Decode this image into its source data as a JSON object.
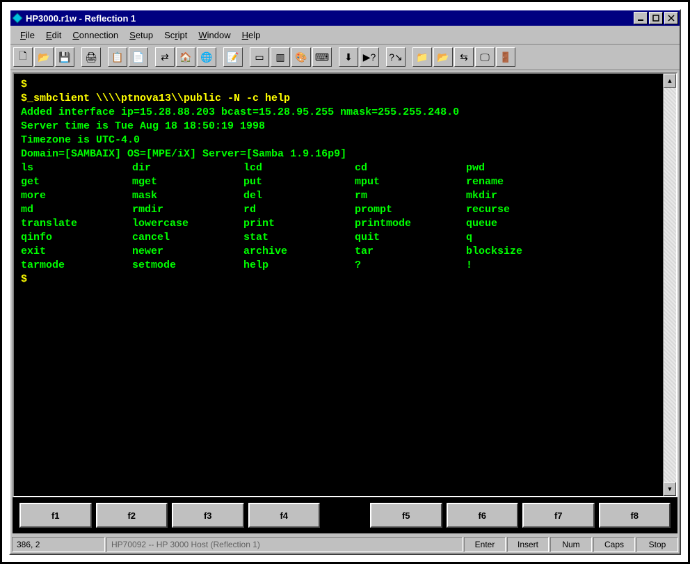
{
  "window": {
    "title": "HP3000.r1w - Reflection 1",
    "icon_name": "app-icon"
  },
  "menu": {
    "items": [
      {
        "label": "File",
        "accel": "F"
      },
      {
        "label": "Edit",
        "accel": "E"
      },
      {
        "label": "Connection",
        "accel": "C"
      },
      {
        "label": "Setup",
        "accel": "S"
      },
      {
        "label": "Script",
        "accel": "r"
      },
      {
        "label": "Window",
        "accel": "W"
      },
      {
        "label": "Help",
        "accel": "H"
      }
    ]
  },
  "toolbar": {
    "buttons": [
      {
        "name": "new-doc-icon",
        "glyph": "🗋"
      },
      {
        "name": "open-folder-icon",
        "glyph": "📂"
      },
      {
        "name": "save-disk-icon",
        "glyph": "💾"
      },
      {
        "sep": true
      },
      {
        "name": "print-icon",
        "glyph": "🖨"
      },
      {
        "sep": true
      },
      {
        "name": "copy-icon",
        "glyph": "📋"
      },
      {
        "name": "paste-icon",
        "glyph": "📄"
      },
      {
        "sep": true
      },
      {
        "name": "connect-icon",
        "glyph": "⇄"
      },
      {
        "name": "home-icon",
        "glyph": "🏠"
      },
      {
        "name": "globe-icon",
        "glyph": "🌐"
      },
      {
        "sep": true
      },
      {
        "name": "notepad-icon",
        "glyph": "📝"
      },
      {
        "sep": true
      },
      {
        "name": "window-a-icon",
        "glyph": "▭"
      },
      {
        "name": "window-b-icon",
        "glyph": "▥"
      },
      {
        "name": "palette-icon",
        "glyph": "🎨"
      },
      {
        "name": "keyboard-icon",
        "glyph": "⌨"
      },
      {
        "sep": true
      },
      {
        "name": "download-icon",
        "glyph": "⬇"
      },
      {
        "name": "run-script-icon",
        "glyph": "▶?"
      },
      {
        "sep": true
      },
      {
        "name": "context-help-icon",
        "glyph": "?↘"
      },
      {
        "sep": true
      },
      {
        "name": "folder-out-icon",
        "glyph": "📁"
      },
      {
        "name": "folder-in-icon",
        "glyph": "📂"
      },
      {
        "name": "transfer-icon",
        "glyph": "⇆"
      },
      {
        "name": "display-icon",
        "glyph": "🖵"
      },
      {
        "name": "exit-icon",
        "glyph": "🚪"
      }
    ]
  },
  "terminal": {
    "prompt": "$",
    "lines_top": [
      {
        "cls": "yellow",
        "text": "$"
      },
      {
        "cls": "yellow",
        "text": "$_smbclient \\\\\\\\ptnova13\\\\public -N -c help"
      },
      {
        "cls": "green",
        "text": "Added interface ip=15.28.88.203 bcast=15.28.95.255 nmask=255.255.248.0"
      },
      {
        "cls": "green",
        "text": "Server time is Tue Aug 18 18:50:19 1998"
      },
      {
        "cls": "green",
        "text": "Timezone is UTC-4.0"
      },
      {
        "cls": "green",
        "text": "Domain=[SAMBAIX] OS=[MPE/iX] Server=[Samba 1.9.16p9]"
      }
    ],
    "command_grid": [
      [
        "ls",
        "dir",
        "lcd",
        "cd",
        "pwd"
      ],
      [
        "get",
        "mget",
        "put",
        "mput",
        "rename"
      ],
      [
        "more",
        "mask",
        "del",
        "rm",
        "mkdir"
      ],
      [
        "md",
        "rmdir",
        "rd",
        "prompt",
        "recurse"
      ],
      [
        "translate",
        "lowercase",
        "print",
        "printmode",
        "queue"
      ],
      [
        "qinfo",
        "cancel",
        "stat",
        "quit",
        "q"
      ],
      [
        "exit",
        "newer",
        "archive",
        "tar",
        "blocksize"
      ],
      [
        "tarmode",
        "setmode",
        "help",
        "?",
        "!"
      ]
    ],
    "lines_bottom": [
      {
        "cls": "yellow",
        "text": "$"
      }
    ]
  },
  "fkeys": {
    "left": [
      "f1",
      "f2",
      "f3",
      "f4"
    ],
    "right": [
      "f5",
      "f6",
      "f7",
      "f8"
    ]
  },
  "status": {
    "coords": "386, 2",
    "host": "HP70092 -- HP 3000 Host (Reflection 1)",
    "indicators": [
      "Enter",
      "Insert",
      "Num",
      "Caps",
      "Stop"
    ]
  },
  "colors": {
    "titlebar_bg": "#000080",
    "frame_bg": "#c0c0c0",
    "term_bg": "#000000",
    "term_fg": "#00ff00",
    "term_hi": "#ffff00"
  }
}
